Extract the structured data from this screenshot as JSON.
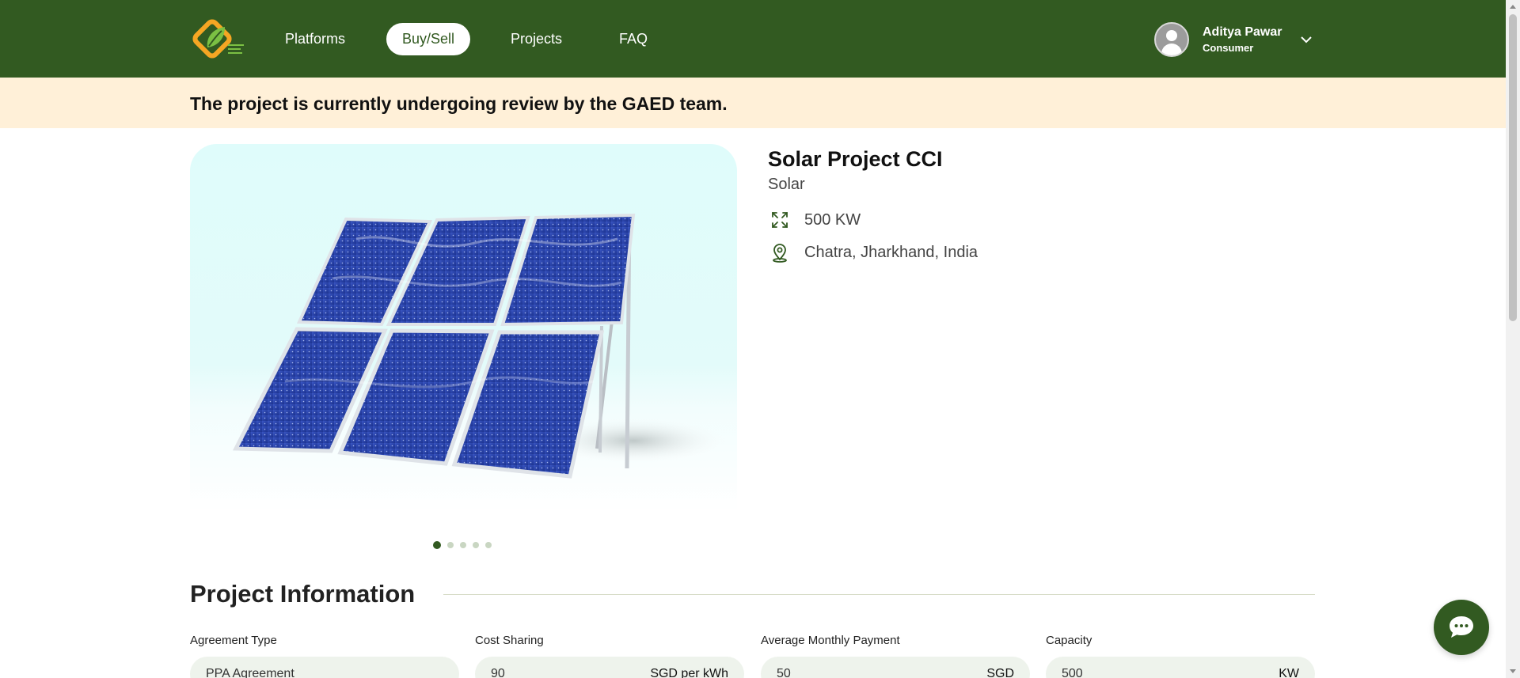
{
  "header": {
    "logo_icon": "gaed-leaf-logo",
    "nav": [
      {
        "label": "Platforms"
      },
      {
        "label": "Buy/Sell",
        "active": true
      },
      {
        "label": "Projects"
      },
      {
        "label": "FAQ"
      }
    ],
    "user": {
      "name": "Aditya Pawar",
      "role": "Consumer",
      "avatar_icon": "user-avatar-icon",
      "menu_icon": "chevron-down-icon"
    }
  },
  "banner": {
    "text": "The project is currently undergoing review by the GAED team."
  },
  "gallery": {
    "image_subject": "solar-panel-array",
    "slide_count": 5,
    "active_slide": 1
  },
  "project": {
    "title": "Solar Project CCI",
    "type": "Solar",
    "capacity": "500 KW",
    "capacity_icon": "expand-arrows-icon",
    "location": "Chatra, Jharkhand, India",
    "location_icon": "map-pin-icon"
  },
  "info": {
    "heading": "Project Information",
    "fields": [
      {
        "label": "Agreement Type",
        "value": "PPA Agreement",
        "unit": ""
      },
      {
        "label": "Cost Sharing",
        "value": "90",
        "unit": "SGD per kWh"
      },
      {
        "label": "Average Monthly Payment",
        "value": "50",
        "unit": "SGD"
      },
      {
        "label": "Capacity",
        "value": "500",
        "unit": "KW"
      }
    ]
  },
  "chat": {
    "icon": "chat-bubble-icon"
  },
  "colors": {
    "primary": "#325a21",
    "banner_bg": "#fff0d8",
    "field_bg": "#eef3ec",
    "accent_logo": "#f5a623"
  }
}
